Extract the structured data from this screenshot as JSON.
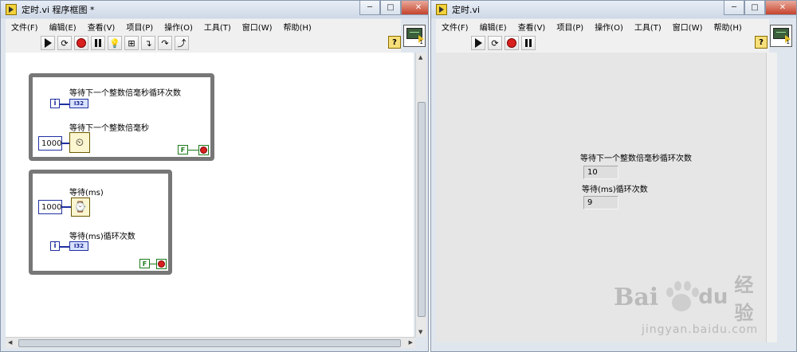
{
  "left_window": {
    "title": "定时.vi 程序框图 *",
    "menu": [
      "文件(F)",
      "编辑(E)",
      "查看(V)",
      "项目(P)",
      "操作(O)",
      "工具(T)",
      "窗口(W)",
      "帮助(H)"
    ],
    "help_label": "?",
    "vi_icon_number": "1",
    "loop1": {
      "iter_label": "i",
      "indicator_label": "等待下一个整数倍毫秒循环次数",
      "type_label": "I32",
      "fn_label": "等待下一个整数倍毫秒",
      "const_value": "1000",
      "bool_label": "F"
    },
    "loop2": {
      "fn_label": "等待(ms)",
      "const_value": "1000",
      "iter_label": "i",
      "indicator_label": "等待(ms)循环次数",
      "type_label": "I32",
      "bool_label": "F"
    }
  },
  "right_window": {
    "title": "定时.vi",
    "menu": [
      "文件(F)",
      "编辑(E)",
      "查看(V)",
      "项目(P)",
      "操作(O)",
      "工具(T)",
      "窗口(W)",
      "帮助(H)"
    ],
    "help_label": "?",
    "vi_icon_number": "1",
    "indicator1": {
      "label": "等待下一个整数倍毫秒循环次数",
      "value": "10"
    },
    "indicator2": {
      "label": "等待(ms)循环次数",
      "value": "9"
    }
  },
  "watermark": {
    "brand": "Bai",
    "brand2": "du",
    "cn": "经验",
    "url": "jingyan.baidu.com"
  }
}
